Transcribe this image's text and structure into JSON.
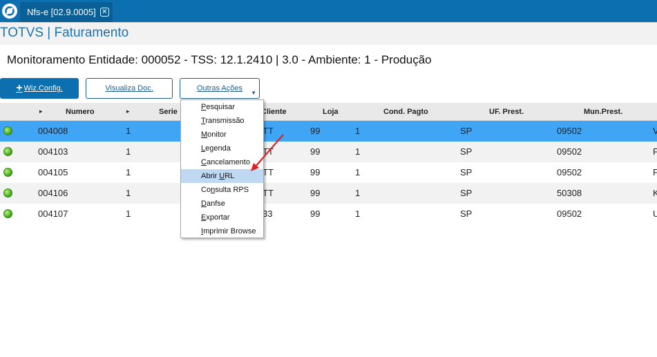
{
  "topbar": {
    "tab_label": "Nfs-e [02.9.0005]",
    "tab_close": "✕"
  },
  "app_title": "TOTVS | Faturamento",
  "header_title": "Monitoramento Entidade: 000052 - TSS: 12.1.2410 | 3.0 - Ambiente: 1 - Produção",
  "toolbar": {
    "wiz_plus": "+",
    "wiz_label": "Wiz.Config.",
    "visualiza_label": "Visualiza Doc.",
    "outras_label": "Outras Ações",
    "outras_caret": "▼"
  },
  "grid": {
    "columns": {
      "numero": "Numero",
      "serie": "Serie",
      "cliente": "Cliente",
      "loja": "Loja",
      "cond_pagto": "Cond. Pagto",
      "uf_prest": "UF. Prest.",
      "mun_prest": "Mun.Prest."
    },
    "sort_glyph": "▸",
    "rows": [
      {
        "numero": "004008",
        "serie": "1",
        "cliente": "TT",
        "loja": "99",
        "cond": "1",
        "uf": "SP",
        "mun": "09502",
        "extra": "V"
      },
      {
        "numero": "004103",
        "serie": "1",
        "cliente": "TT",
        "loja": "99",
        "cond": "1",
        "uf": "SP",
        "mun": "09502",
        "extra": "F"
      },
      {
        "numero": "004105",
        "serie": "1",
        "cliente": "TT",
        "loja": "99",
        "cond": "1",
        "uf": "SP",
        "mun": "09502",
        "extra": "F"
      },
      {
        "numero": "004106",
        "serie": "1",
        "cliente": "TT",
        "loja": "99",
        "cond": "1",
        "uf": "SP",
        "mun": "50308",
        "extra": "K"
      },
      {
        "numero": "004107",
        "serie": "1",
        "cliente": "33",
        "loja": "99",
        "cond": "1",
        "uf": "SP",
        "mun": "09502",
        "extra": "U"
      }
    ]
  },
  "menu": {
    "items": [
      {
        "first": "P",
        "rest": "esquisar"
      },
      {
        "first": "T",
        "rest": "ransmissão"
      },
      {
        "first": "M",
        "rest": "onitor"
      },
      {
        "first": "L",
        "rest": "egenda"
      },
      {
        "first": "C",
        "rest": "ancelamento"
      },
      {
        "first": "Abrir ",
        "mid": "U",
        "rest": "RL"
      },
      {
        "first": "Co",
        "mid": "n",
        "rest": "sulta RPS"
      },
      {
        "first": "D",
        "rest": "anfse"
      },
      {
        "first": "E",
        "rest": "xportar"
      },
      {
        "first": "I",
        "rest": "mprimir Browse"
      }
    ]
  },
  "colors": {
    "brand": "#0b6fb0",
    "selected_row": "#41a5f5",
    "menu_highlight": "#bfd9f3",
    "arrow": "#e02020",
    "status_green": "#3aa312"
  }
}
